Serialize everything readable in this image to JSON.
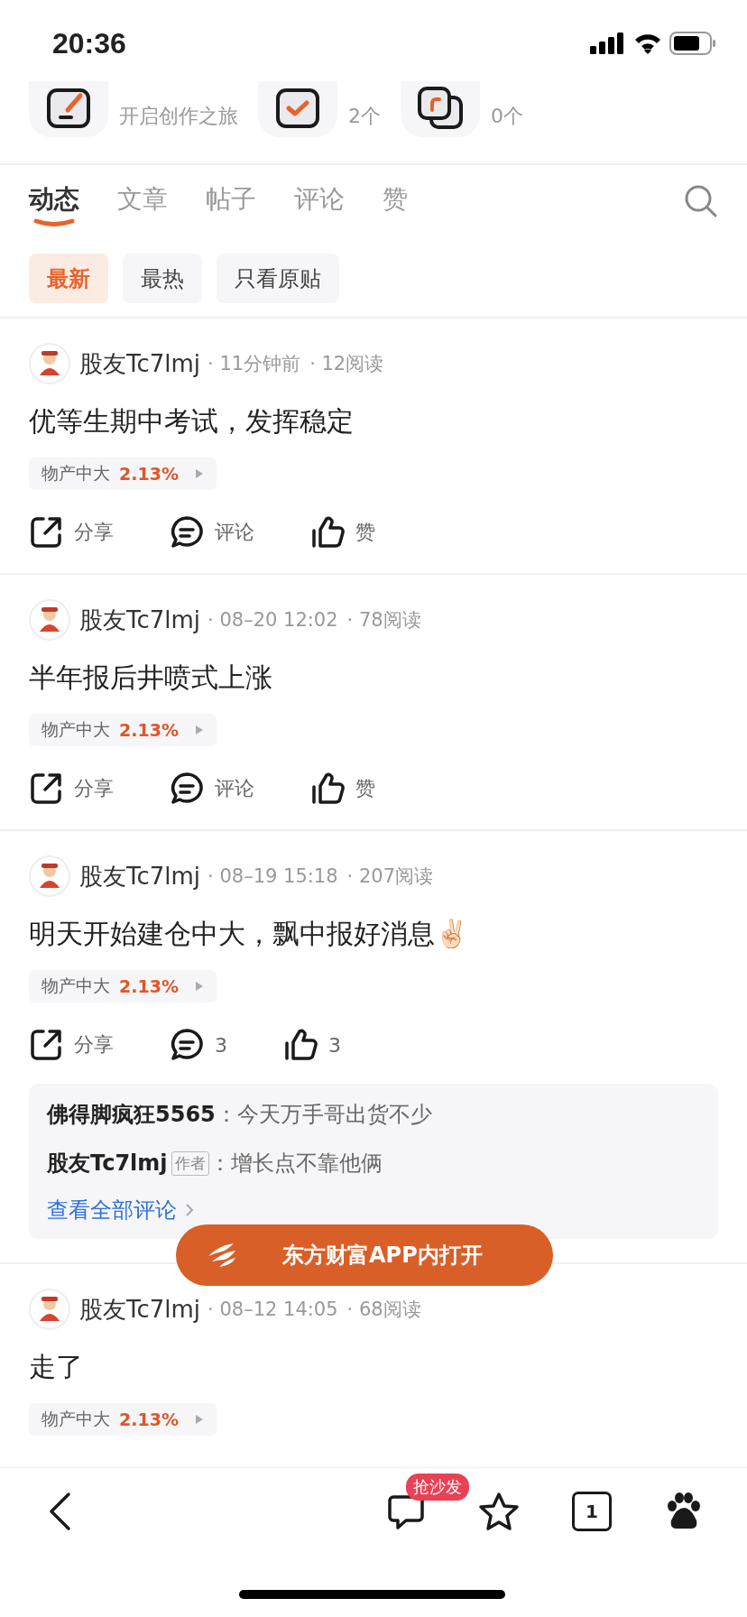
{
  "status_bar": {
    "time": "20:36"
  },
  "shortcuts": [
    {
      "kind": "create",
      "subtitle": "开启创作之旅"
    },
    {
      "kind": "watchlist",
      "subtitle": "2个"
    },
    {
      "kind": "portfolio",
      "subtitle": "0个"
    }
  ],
  "tabs": [
    {
      "label": "动态",
      "selected": true
    },
    {
      "label": "文章",
      "selected": false
    },
    {
      "label": "帖子",
      "selected": false
    },
    {
      "label": "评论",
      "selected": false
    },
    {
      "label": "赞",
      "selected": false
    }
  ],
  "filters": [
    {
      "label": "最新",
      "selected": true
    },
    {
      "label": "最热",
      "selected": false
    },
    {
      "label": "只看原贴",
      "selected": false
    }
  ],
  "posts": [
    {
      "author": "股友Tc7lmj",
      "time": "· 11分钟前",
      "reads": "· 12阅读",
      "title": "优等生期中考试，发挥稳定",
      "stock": {
        "name": "物产中大",
        "change": "2.13%"
      },
      "actions": {
        "share": "分享",
        "comment": "评论",
        "like": "赞"
      }
    },
    {
      "author": "股友Tc7lmj",
      "time": "· 08–20 12:02",
      "reads": "· 78阅读",
      "title": "半年报后井喷式上涨",
      "stock": {
        "name": "物产中大",
        "change": "2.13%"
      },
      "actions": {
        "share": "分享",
        "comment": "评论",
        "like": "赞"
      }
    },
    {
      "author": "股友Tc7lmj",
      "time": "· 08–19 15:18",
      "reads": "· 207阅读",
      "title": "明天开始建仓中大，飘中报好消息✌🏻",
      "stock": {
        "name": "物产中大",
        "change": "2.13%"
      },
      "actions": {
        "share": "分享",
        "comment": "3",
        "like": "3"
      },
      "comments": [
        {
          "author": "佛得脚疯狂5565",
          "text": "：今天万手哥出货不少"
        },
        {
          "author": "股友Tc7lmj",
          "badge": "作者",
          "text": "：增长点不靠他俩"
        }
      ],
      "more_comments": "查看全部评论"
    },
    {
      "author": "股友Tc7lmj",
      "time": "· 08–12 14:05",
      "reads": "· 68阅读",
      "title": "走了",
      "stock": {
        "name": "物产中大",
        "change": "2.13%"
      }
    }
  ],
  "open_app_button": "东方财富APP内打开",
  "bottom_bar": {
    "comment_badge": "抢沙发",
    "tab_count": "1"
  }
}
